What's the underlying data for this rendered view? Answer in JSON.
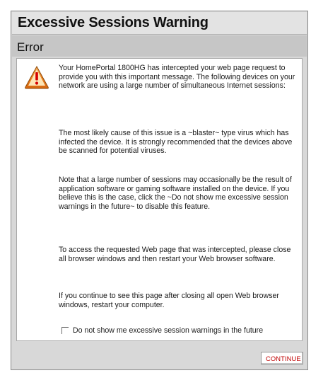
{
  "page": {
    "title": "Excessive Sessions Warning"
  },
  "section": {
    "title": "Error"
  },
  "message": {
    "paragraphs": [
      "Your HomePortal 1800HG has intercepted your web page request to provide you with this important message. The following devices on your network are using a large number of simultaneous Internet sessions:",
      "The most likely cause of this issue is a ~blaster~ type virus which has infected the device. It is strongly recommended that the devices above be scanned for potential viruses.",
      "Note that a large number of sessions may occasionally be the result of application software or gaming software installed on the device. If you believe this is the case, click the ~Do not show me excessive session warnings in the future~ to disable this feature.",
      "To access the requested Web page that was intercepted, please close all browser windows and then restart your Web browser software.",
      "If you continue to see this page after closing all open Web browser windows, restart your computer."
    ]
  },
  "checkbox": {
    "label": "Do not show me excessive session warnings in the future",
    "checked": false
  },
  "actions": {
    "continue_label": "CONTINUE"
  },
  "colors": {
    "button_text": "#c00000",
    "warning_icon_fill": "#e87919",
    "warning_icon_mark": "#d60000"
  },
  "icons": {
    "warning": "warning-triangle-icon"
  }
}
